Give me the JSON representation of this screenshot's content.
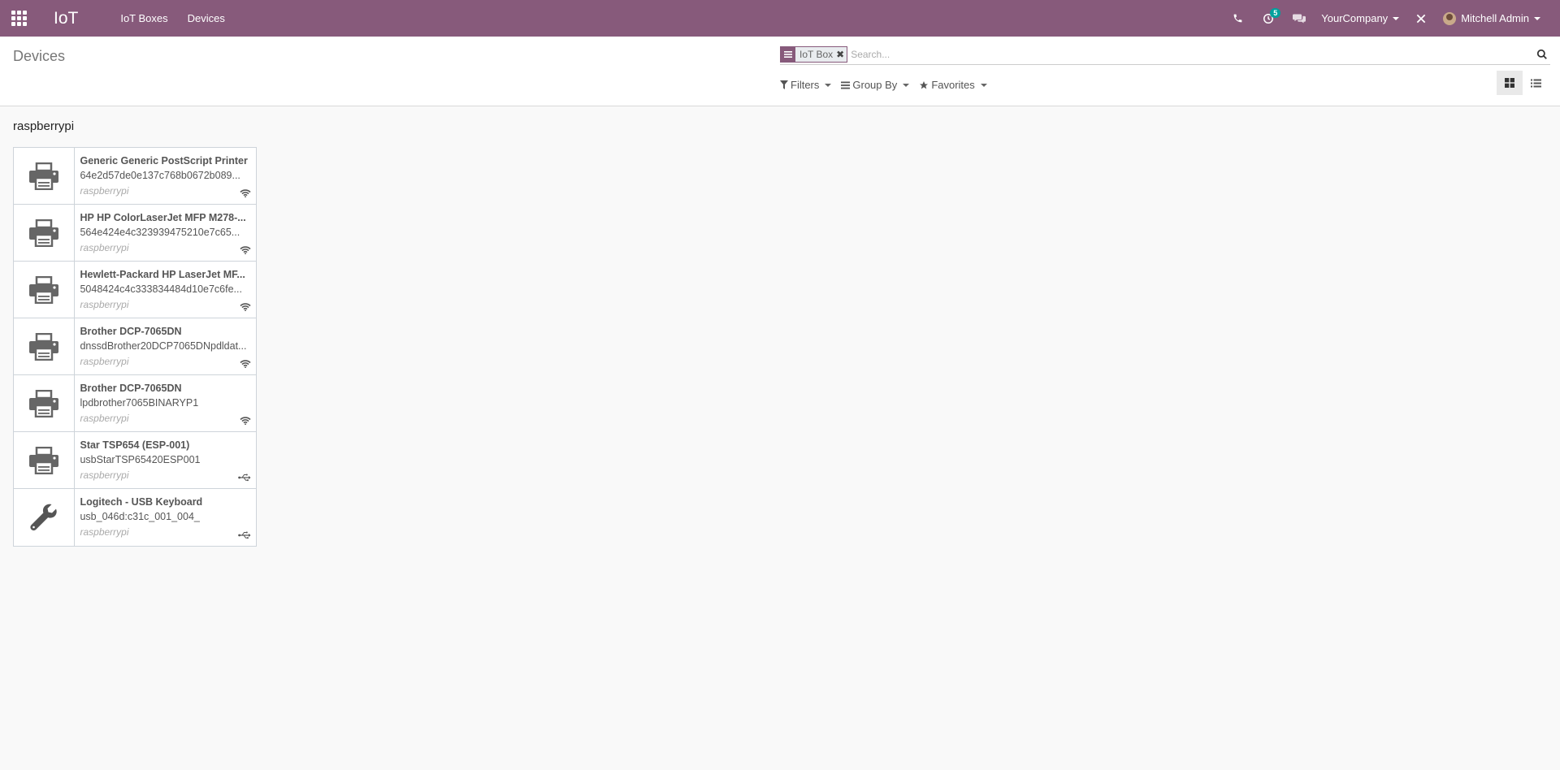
{
  "navbar": {
    "brand": "IoT",
    "menu": [
      {
        "label": "IoT Boxes"
      },
      {
        "label": "Devices"
      }
    ],
    "activities_count": "5",
    "company": "YourCompany",
    "user": "Mitchell Admin",
    "color": "#875a7b"
  },
  "control_panel": {
    "breadcrumb": "Devices",
    "search": {
      "facet_value": "IoT Box",
      "placeholder": "Search..."
    },
    "filters_label": "Filters",
    "groupby_label": "Group By",
    "favorites_label": "Favorites"
  },
  "group": {
    "title": "raspberrypi"
  },
  "devices": [
    {
      "name": "Generic Generic PostScript Printer",
      "identifier": "64e2d57de0e137c768b0672b089...",
      "box": "raspberrypi",
      "type_icon": "printer-icon",
      "connection": "network"
    },
    {
      "name": "HP HP ColorLaserJet MFP M278-...",
      "identifier": "564e424e4c323939475210e7c65...",
      "box": "raspberrypi",
      "type_icon": "printer-icon",
      "connection": "network"
    },
    {
      "name": "Hewlett-Packard HP LaserJet MF...",
      "identifier": "5048424c4c333834484d10e7c6fe...",
      "box": "raspberrypi",
      "type_icon": "printer-icon",
      "connection": "network"
    },
    {
      "name": "Brother DCP-7065DN",
      "identifier": "dnssdBrother20DCP7065DNpdldat...",
      "box": "raspberrypi",
      "type_icon": "printer-icon",
      "connection": "network"
    },
    {
      "name": "Brother DCP-7065DN",
      "identifier": "lpdbrother7065BINARYP1",
      "box": "raspberrypi",
      "type_icon": "printer-icon",
      "connection": "network"
    },
    {
      "name": "Star TSP654 (ESP-001)",
      "identifier": "usbStarTSP65420ESP001",
      "box": "raspberrypi",
      "type_icon": "printer-icon",
      "connection": "usb"
    },
    {
      "name": "Logitech - USB Keyboard",
      "identifier": "usb_046d:c31c_001_004_",
      "box": "raspberrypi",
      "type_icon": "wrench-icon",
      "connection": "usb"
    }
  ]
}
